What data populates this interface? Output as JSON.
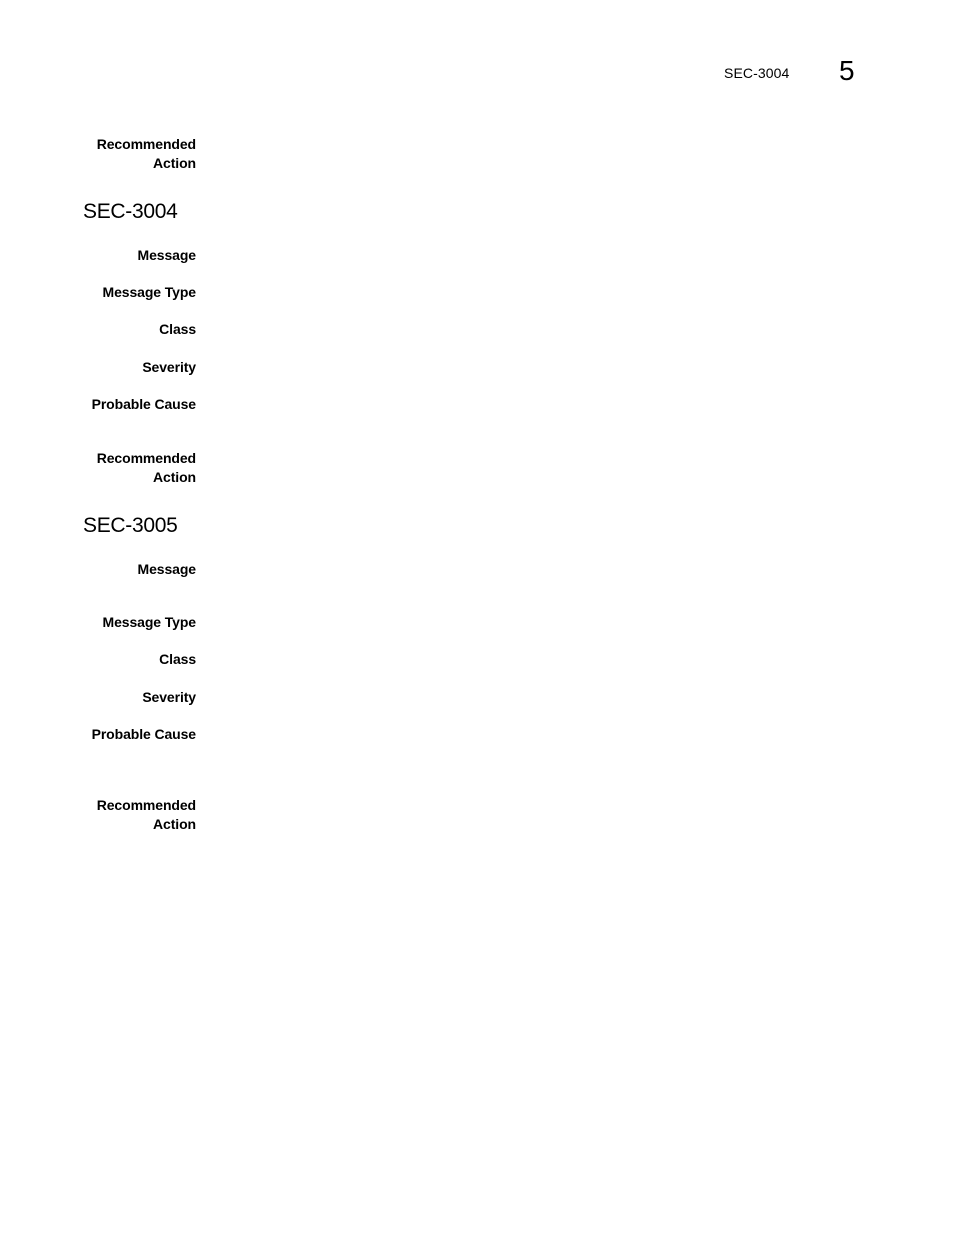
{
  "header": {
    "running_code": "SEC-3004",
    "chapter_number": "5"
  },
  "top_fragment": {
    "recommended_action_label": [
      "Recommended",
      "Action"
    ],
    "recommended_action_value": ""
  },
  "sections": [
    {
      "title": "SEC-3004",
      "fields": {
        "message_label": "Message",
        "message_value": "",
        "message_type_label": "Message Type",
        "message_type_value": "",
        "class_label": "Class",
        "class_value": "",
        "severity_label": "Severity",
        "severity_value": "",
        "probable_cause_label": "Probable Cause",
        "probable_cause_value": "",
        "recommended_action_label": [
          "Recommended",
          "Action"
        ],
        "recommended_action_value": ""
      }
    },
    {
      "title": "SEC-3005",
      "fields": {
        "message_label": "Message",
        "message_value": "",
        "message_type_label": "Message Type",
        "message_type_value": "",
        "class_label": "Class",
        "class_value": "",
        "severity_label": "Severity",
        "severity_value": "",
        "probable_cause_label": "Probable Cause",
        "probable_cause_value": "",
        "recommended_action_label": [
          "Recommended",
          "Action"
        ],
        "recommended_action_value": ""
      }
    }
  ]
}
